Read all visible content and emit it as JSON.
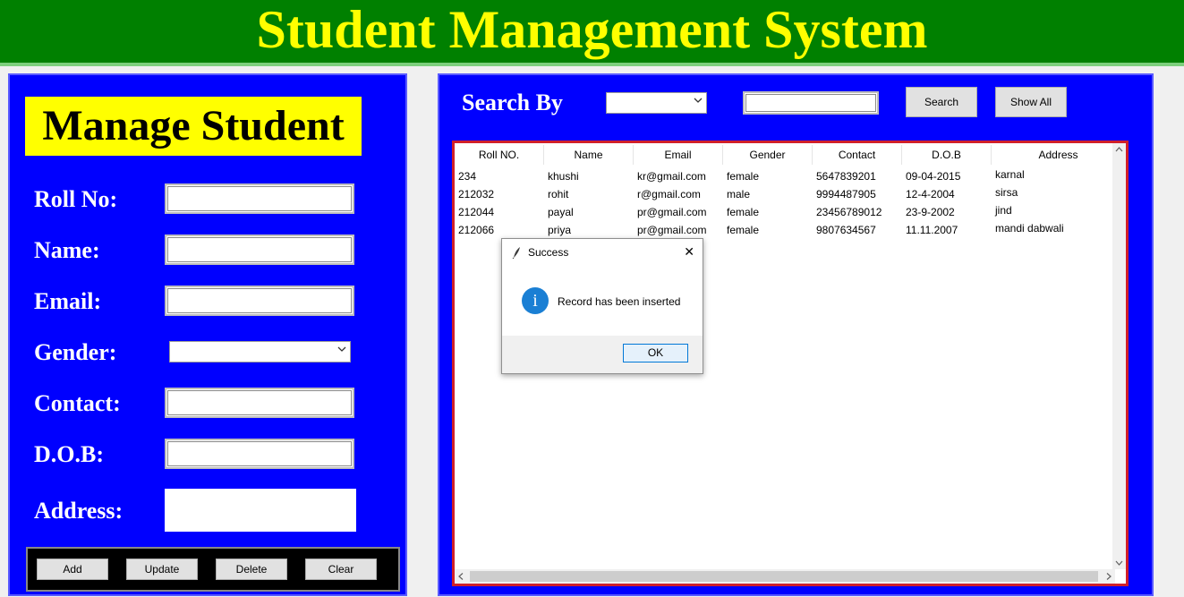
{
  "header": {
    "title": "Student Management System"
  },
  "form": {
    "title": "Manage Student",
    "roll_label": "Roll No:",
    "name_label": "Name:",
    "email_label": "Email:",
    "gender_label": "Gender:",
    "contact_label": "Contact:",
    "dob_label": "D.O.B:",
    "address_label": "Address:",
    "buttons": {
      "add": "Add",
      "update": "Update",
      "delete": "Delete",
      "clear": "Clear"
    }
  },
  "search": {
    "label": "Search By",
    "search_button": "Search",
    "show_all_button": "Show All"
  },
  "table": {
    "columns": [
      "Roll NO.",
      "Name",
      "Email",
      "Gender",
      "Contact",
      "D.O.B",
      "Address"
    ],
    "rows": [
      [
        "234",
        "khushi",
        "kr@gmail.com",
        "female",
        "5647839201",
        "09-04-2015",
        "karnal"
      ],
      [
        "212032",
        "rohit",
        "r@gmail.com",
        "male",
        "9994487905",
        "12-4-2004",
        "sirsa"
      ],
      [
        "212044",
        "payal",
        "pr@gmail.com",
        "female",
        "23456789012",
        "23-9-2002",
        "jind"
      ],
      [
        "212066",
        "priya",
        "pr@gmail.com",
        "female",
        "9807634567",
        "11.11.2007",
        "mandi dabwali"
      ]
    ]
  },
  "dialog": {
    "title": "Success",
    "message": "Record has been inserted",
    "ok_label": "OK",
    "info_icon_glyph": "i",
    "close_glyph": "✕"
  },
  "colors": {
    "header_bg": "#008000",
    "header_text": "#ffff00",
    "frame_bg": "#0000ff",
    "title_bg": "#ffff00",
    "table_border": "#d0202a",
    "info_icon": "#1a7fd4"
  },
  "icons": {
    "dialog_app": "feather-icon",
    "dialog_info": "info-icon",
    "dialog_close": "close-icon",
    "combo_arrow": "chevron-down-icon"
  }
}
